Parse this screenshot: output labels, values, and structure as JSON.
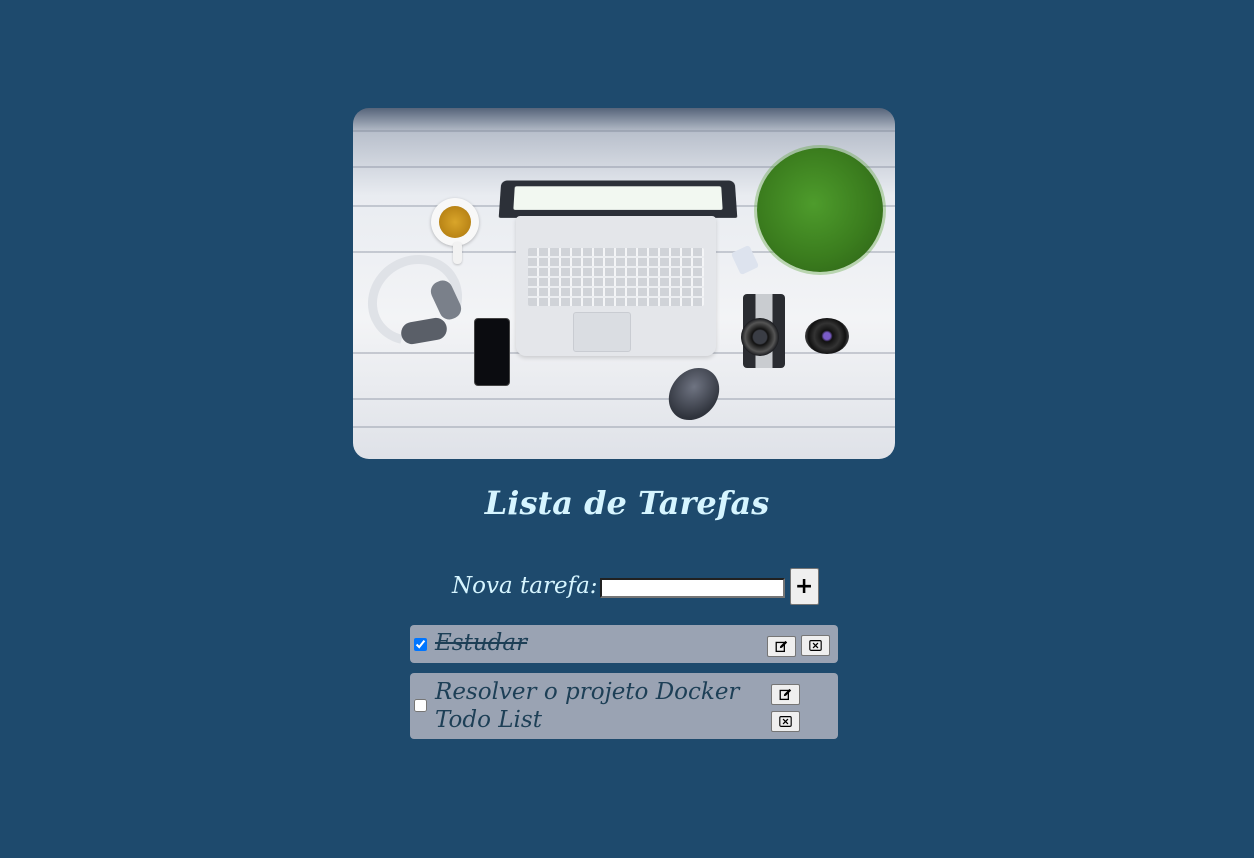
{
  "hero": {
    "image_alt": "Desk with laptop, coffee cup, headphones, phone, mouse, camera and plant"
  },
  "page_title": "Lista de Tarefas",
  "new_task": {
    "label": "Nova tarefa:",
    "input_value": "",
    "add_button_label": "+"
  },
  "tasks": [
    {
      "text": "Estudar",
      "done": true
    },
    {
      "text": "Resolver o projeto Docker Todo List",
      "done": false
    }
  ],
  "icons": {
    "edit": "edit-icon",
    "delete": "delete-icon"
  },
  "colors": {
    "background": "#1e4a6d",
    "title": "#d6f5ff",
    "task_bg": "#9aa3b3",
    "task_text": "#1d3f56"
  }
}
